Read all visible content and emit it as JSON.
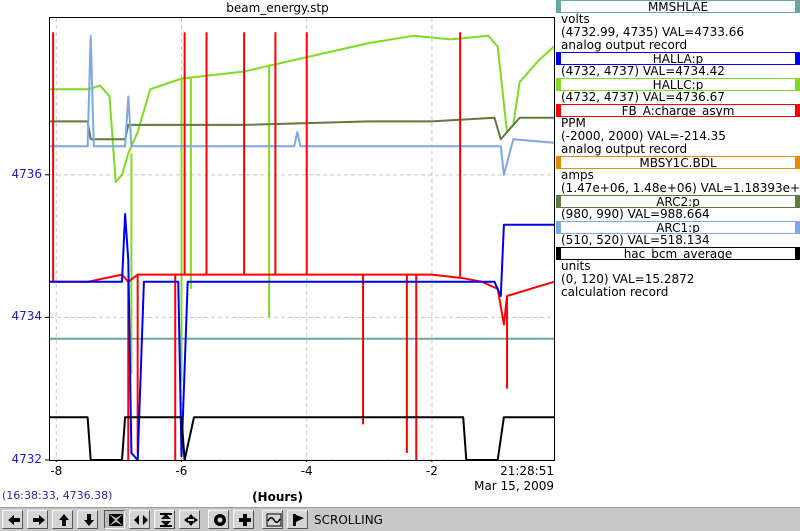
{
  "plot": {
    "title": "beam_energy.stp",
    "x_axis_label": "(Hours)",
    "x_end_time": "21:28:51",
    "x_end_date": "Mar 15, 2009",
    "cursor_readout": "(16:38:33, 4736.38)"
  },
  "chart_data": {
    "type": "line",
    "title": "beam_energy.stp",
    "xlabel": "(Hours)",
    "ylabel": "",
    "xlim": [
      -8.1,
      -0.05
    ],
    "ylim": [
      4732,
      4738.2
    ],
    "x_ticks": [
      -8,
      -6,
      -4,
      -2
    ],
    "x_tick_labels": [
      "-8",
      "-6",
      "-4",
      "-2"
    ],
    "y_ticks": [
      4732,
      4734,
      4736
    ],
    "y_tick_labels": [
      "4732",
      "4734",
      "4736"
    ],
    "grid": true,
    "legend_placement": "right",
    "series": [
      {
        "name": "HALLC:p",
        "color": "#7ddc1f",
        "points": [
          [
            -8.1,
            4737.2
          ],
          [
            -7.5,
            4737.2
          ],
          [
            -7.3,
            4737.25
          ],
          [
            -7.15,
            4737.1
          ],
          [
            -7.05,
            4735.9
          ],
          [
            -6.95,
            4736.0
          ],
          [
            -6.85,
            4736.3
          ],
          [
            -6.7,
            4736.6
          ],
          [
            -6.5,
            4737.2
          ],
          [
            -6.0,
            4737.35
          ],
          [
            -5.0,
            4737.45
          ],
          [
            -4.5,
            4737.55
          ],
          [
            -4.0,
            4737.65
          ],
          [
            -3.5,
            4737.75
          ],
          [
            -3.0,
            4737.85
          ],
          [
            -2.3,
            4737.95
          ],
          [
            -1.7,
            4737.9
          ],
          [
            -1.1,
            4737.95
          ],
          [
            -0.95,
            4737.8
          ],
          [
            -0.8,
            4736.6
          ],
          [
            -0.7,
            4736.7
          ],
          [
            -0.6,
            4737.3
          ],
          [
            -0.3,
            4737.6
          ],
          [
            -0.05,
            4737.8
          ]
        ],
        "spikes": [
          {
            "x": -6.8,
            "to": 4733.2
          },
          {
            "x": -6.0,
            "to": 4733.1
          },
          {
            "x": -5.85,
            "to": 4734.4
          },
          {
            "x": -4.6,
            "to": 4734.0
          }
        ]
      },
      {
        "name": "ARC2:p",
        "color": "#5f7a3f",
        "points": [
          [
            -8.1,
            4736.75
          ],
          [
            -7.5,
            4736.75
          ],
          [
            -7.45,
            4736.5
          ],
          [
            -6.9,
            4736.5
          ],
          [
            -6.85,
            4736.7
          ],
          [
            -6.5,
            4736.7
          ],
          [
            -5.0,
            4736.7
          ],
          [
            -3.0,
            4736.75
          ],
          [
            -2.0,
            4736.75
          ],
          [
            -1.0,
            4736.8
          ],
          [
            -0.9,
            4736.5
          ],
          [
            -0.6,
            4736.8
          ],
          [
            -0.05,
            4736.8
          ]
        ]
      },
      {
        "name": "ARC1:p",
        "color": "#7ea7e6",
        "points": [
          [
            -8.1,
            4736.4
          ],
          [
            -7.5,
            4736.4
          ],
          [
            -7.45,
            4737.95
          ],
          [
            -7.4,
            4736.4
          ],
          [
            -6.9,
            4736.4
          ],
          [
            -6.85,
            4737.1
          ],
          [
            -6.8,
            4736.4
          ],
          [
            -5.2,
            4736.4
          ],
          [
            -4.2,
            4736.4
          ],
          [
            -4.15,
            4736.6
          ],
          [
            -4.1,
            4736.4
          ],
          [
            -2.2,
            4736.4
          ],
          [
            -1.3,
            4736.4
          ],
          [
            -0.9,
            4736.4
          ],
          [
            -0.85,
            4736.0
          ],
          [
            -0.7,
            4736.5
          ],
          [
            -0.05,
            4736.45
          ]
        ]
      },
      {
        "name": "MMSHLAE",
        "color": "#6aa6a0",
        "points": [
          [
            -8.1,
            4733.7
          ],
          [
            -0.05,
            4733.7
          ]
        ]
      },
      {
        "name": "FB_A:charge_asym",
        "color": "#ff0000",
        "points": [
          [
            -8.1,
            4734.5
          ],
          [
            -7.5,
            4734.5
          ],
          [
            -6.95,
            4734.6
          ],
          [
            -6.85,
            4734.5
          ],
          [
            -6.7,
            4734.6
          ],
          [
            -6.0,
            4734.6
          ],
          [
            -4.0,
            4734.6
          ],
          [
            -2.0,
            4734.6
          ],
          [
            -1.5,
            4734.55
          ],
          [
            -1.2,
            4734.5
          ],
          [
            -0.95,
            4734.4
          ],
          [
            -0.85,
            4733.9
          ],
          [
            -0.8,
            4734.3
          ],
          [
            -0.05,
            4734.5
          ]
        ],
        "spikes": [
          {
            "x": -8.05,
            "to": 4738.0
          },
          {
            "x": -6.85,
            "to": 4732.0
          },
          {
            "x": -6.7,
            "to": 4732.1
          },
          {
            "x": -6.1,
            "to": 4732.0
          },
          {
            "x": -5.95,
            "to": 4738.0
          },
          {
            "x": -5.6,
            "to": 4738.0
          },
          {
            "x": -5.0,
            "to": 4738.0
          },
          {
            "x": -4.5,
            "to": 4738.0
          },
          {
            "x": -4.0,
            "to": 4738.0
          },
          {
            "x": -3.1,
            "to": 4732.5
          },
          {
            "x": -2.4,
            "to": 4732.1
          },
          {
            "x": -2.25,
            "to": 4732.0
          },
          {
            "x": -1.55,
            "to": 4738.0
          },
          {
            "x": -0.8,
            "to": 4733.0
          }
        ]
      },
      {
        "name": "MBSY1C.BDL",
        "color": "#e68a00",
        "points": []
      },
      {
        "name": "HALLA:p",
        "color": "#0000ee",
        "points": [
          [
            -8.1,
            4734.5
          ],
          [
            -7.5,
            4734.5
          ],
          [
            -6.95,
            4734.5
          ],
          [
            -6.9,
            4735.45
          ],
          [
            -6.85,
            4734.8
          ],
          [
            -6.8,
            4732.1
          ],
          [
            -6.7,
            4732.0
          ],
          [
            -6.6,
            4734.5
          ],
          [
            -6.05,
            4734.5
          ],
          [
            -6.0,
            4732.05
          ],
          [
            -5.9,
            4734.5
          ],
          [
            -4.0,
            4734.5
          ],
          [
            -2.0,
            4734.5
          ],
          [
            -1.0,
            4734.5
          ],
          [
            -0.9,
            4734.3
          ],
          [
            -0.85,
            4735.3
          ],
          [
            -0.05,
            4735.3
          ]
        ]
      },
      {
        "name": "hac_bcm_average",
        "color": "#000000",
        "points": [
          [
            -8.1,
            4732.6
          ],
          [
            -7.5,
            4732.6
          ],
          [
            -7.45,
            4732.0
          ],
          [
            -6.95,
            4732.0
          ],
          [
            -6.9,
            4732.6
          ],
          [
            -6.6,
            4732.6
          ],
          [
            -6.0,
            4732.6
          ],
          [
            -5.95,
            4732.0
          ],
          [
            -5.8,
            4732.6
          ],
          [
            -4.8,
            4732.6
          ],
          [
            -3.5,
            4732.6
          ],
          [
            -2.4,
            4732.6
          ],
          [
            -2.2,
            4732.6
          ],
          [
            -1.5,
            4732.6
          ],
          [
            -1.45,
            4732.0
          ],
          [
            -0.95,
            4732.0
          ],
          [
            -0.85,
            4732.6
          ],
          [
            -0.05,
            4732.6
          ]
        ]
      }
    ]
  },
  "legend": [
    {
      "name": "MMSHLAE",
      "color": "#6aa6a0",
      "lines": [
        "volts",
        "(4732.99, 4735)  VAL=4733.66",
        "analog output record"
      ]
    },
    {
      "name": "HALLA:p",
      "color": "#0000ee",
      "lines": [
        "(4732, 4737) VAL=4734.42"
      ]
    },
    {
      "name": "HALLC:p",
      "color": "#7ddc1f",
      "lines": [
        "(4732, 4737) VAL=4736.67"
      ]
    },
    {
      "name": "FB_A:charge_asym",
      "color": "#ff0000",
      "lines": [
        "PPM",
        "(-2000, 2000) VAL=-214.35",
        "analog output record"
      ]
    },
    {
      "name": "MBSY1C.BDL",
      "color": "#e68a00",
      "lines": [
        "amps",
        "(1.47e+06, 1.48e+06)  VAL=1.18393e+06"
      ]
    },
    {
      "name": "ARC2:p",
      "color": "#5f7a3f",
      "lines": [
        "(980, 990) VAL=988.664"
      ]
    },
    {
      "name": "ARC1:p",
      "color": "#7ea7e6",
      "lines": [
        "(510, 520) VAL=518.134"
      ]
    },
    {
      "name": "hac_bcm_average",
      "color": "#000000",
      "lines": [
        "units",
        "(0, 120) VAL=15.2872",
        "calculation record"
      ]
    }
  ],
  "toolbar": {
    "buttons": [
      {
        "name": "scroll-left-button",
        "icon": "arrow-left-icon"
      },
      {
        "name": "scroll-right-button",
        "icon": "arrow-right-icon"
      },
      {
        "name": "scroll-up-button",
        "icon": "arrow-up-icon"
      },
      {
        "name": "scroll-down-button",
        "icon": "arrow-down-icon"
      },
      {
        "name": "zoom-full-button",
        "icon": "zoom-full-icon"
      },
      {
        "name": "zoom-horizontal-button",
        "icon": "zoom-horizontal-icon"
      },
      {
        "name": "zoom-vertical-button",
        "icon": "zoom-vertical-icon"
      },
      {
        "name": "zoom-in-button",
        "icon": "zoom-in-icon"
      },
      {
        "name": "config-button",
        "icon": "gear-icon"
      },
      {
        "name": "add-button",
        "icon": "plus-icon"
      },
      {
        "name": "mode-button",
        "icon": "wave-icon"
      },
      {
        "name": "flag-button",
        "icon": "flag-icon"
      }
    ],
    "mode_label": "SCROLLING"
  }
}
